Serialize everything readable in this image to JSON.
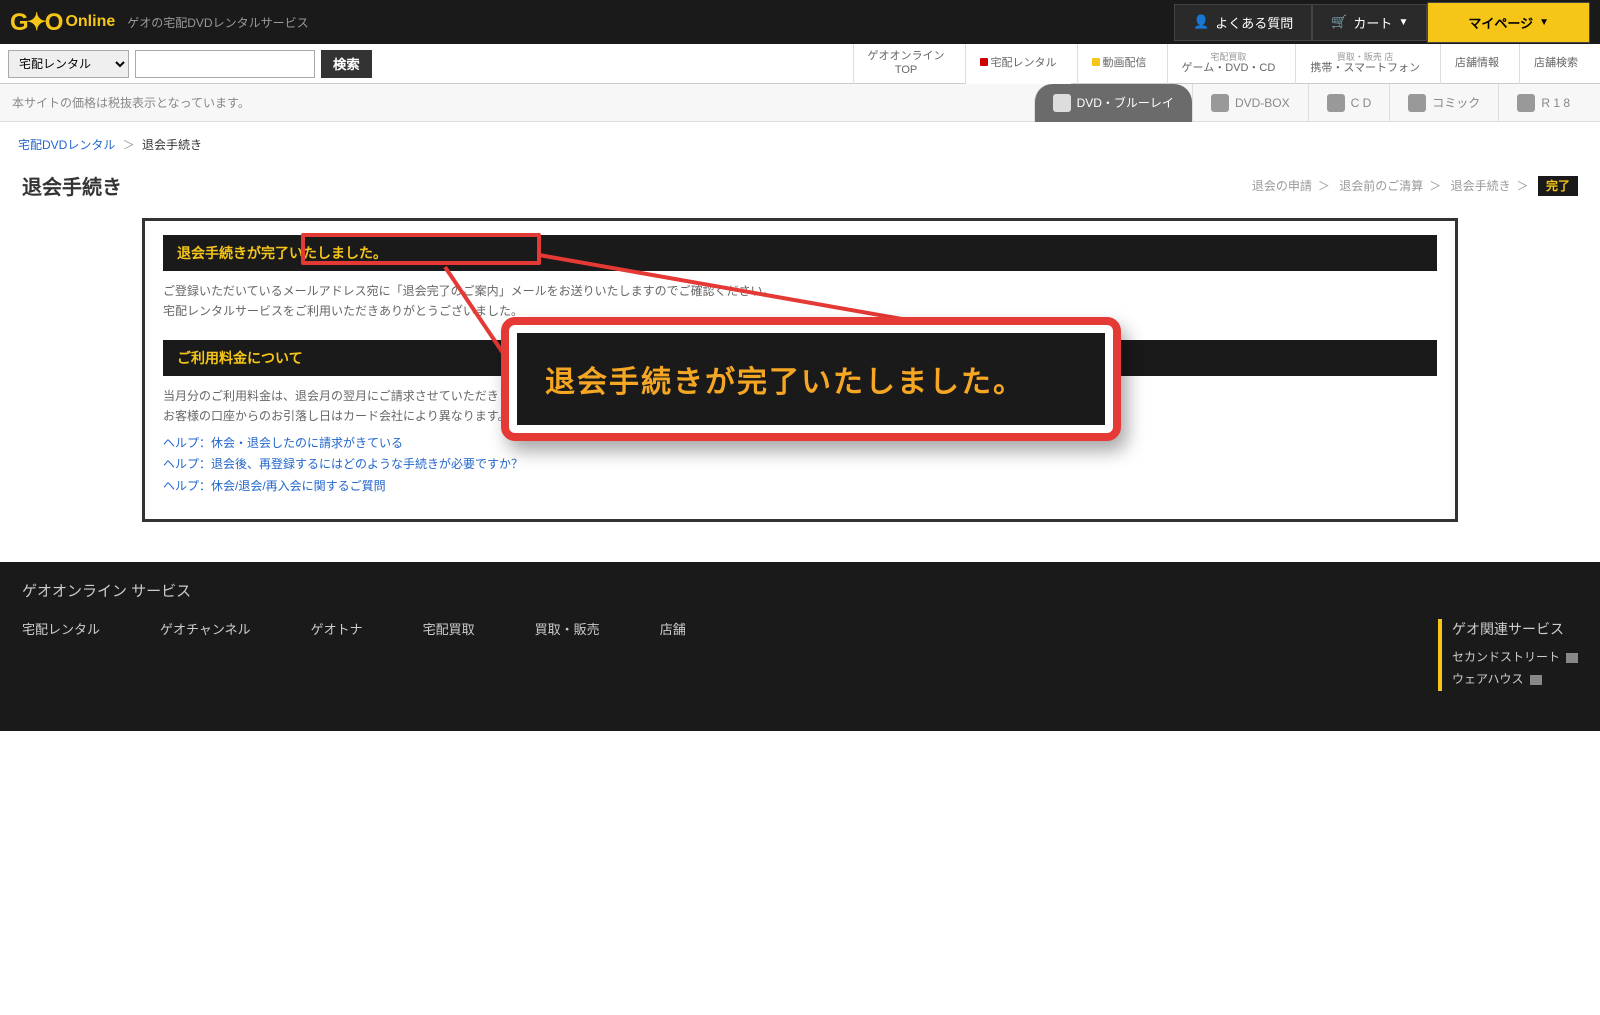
{
  "header": {
    "logo_brand": "G✦O",
    "logo_text": "Online",
    "tagline": "ゲオの宅配DVDレンタルサービス",
    "faq": "よくある質問",
    "cart": "カート",
    "mypage": "マイページ"
  },
  "nav": {
    "category": "宅配レンタル",
    "search_btn": "検索",
    "tabs": [
      {
        "line1": "ゲオオンライン",
        "line2": "TOP"
      },
      {
        "line1": "宅配レンタル"
      },
      {
        "line1": "動画配信"
      },
      {
        "small": "宅配買取",
        "line1": "ゲーム・DVD・CD"
      },
      {
        "small": "買取・販売 店",
        "line1": "携帯・スマートフォン"
      },
      {
        "line1": "店舗情報"
      },
      {
        "line1": "店舗検索"
      }
    ]
  },
  "subnav": {
    "notice": "本サイトの価格は税抜表示となっています。",
    "tabs": [
      "DVD・ブルーレイ",
      "DVD-BOX",
      "C D",
      "コミック",
      "R 1 8"
    ]
  },
  "breadcrumb": {
    "root": "宅配DVDレンタル",
    "current": "退会手続き"
  },
  "page": {
    "title": "退会手続き",
    "steps": [
      "退会の申請",
      "退会前のご清算",
      "退会手続き"
    ],
    "done": "完了"
  },
  "box1": {
    "header": "退会手続きが完了いたしました。",
    "line1": "ご登録いただいているメールアドレス宛に「退会完了のご案内」メールをお送りいたしますのでご確認ください。",
    "line2": "宅配レンタルサービスをご利用いただきありがとうございました。"
  },
  "box2": {
    "header": "ご利用料金について",
    "line1": "当月分のご利用料金は、退会月の翌月にご請求させていただきます。",
    "line2": "お客様の口座からのお引落し日はカード会社により異なります。",
    "helps": [
      "ヘルプ：休会・退会したのに請求がきている",
      "ヘルプ：退会後、再登録するにはどのような手続きが必要ですか？",
      "ヘルプ：休会/退会/再入会に関するご質問"
    ]
  },
  "callout": {
    "text": "退会手続きが完了いたしました。"
  },
  "footer": {
    "title": "ゲオオンライン サービス",
    "cols": [
      "宅配レンタル",
      "ゲオチャンネル",
      "ゲオトナ",
      "宅配買取",
      "買取・販売",
      "店舗"
    ],
    "right_title": "ゲオ関連サービス",
    "right_links": [
      "セカンドストリート",
      "ウェアハウス"
    ]
  }
}
